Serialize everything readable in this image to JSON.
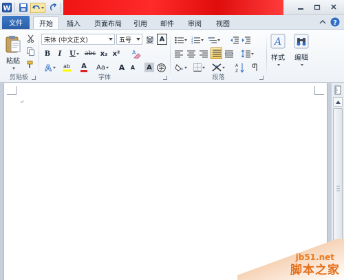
{
  "title_bar": {
    "qat": [
      "word-icon",
      "save-icon",
      "undo-icon",
      "redo-icon",
      "customize-icon"
    ]
  },
  "tabs": {
    "file": "文件",
    "items": [
      "开始",
      "插入",
      "页面布局",
      "引用",
      "邮件",
      "审阅",
      "视图"
    ],
    "active": "开始"
  },
  "clipboard": {
    "paste": "粘贴",
    "label": "剪贴板"
  },
  "font": {
    "name": "宋体 (中文正文)",
    "size": "五号",
    "label": "字体",
    "bold": "B",
    "italic": "I",
    "underline": "U",
    "strike": "abc",
    "subscript": "x₂",
    "superscript": "x²",
    "case": "Aa",
    "grow": "A",
    "shrink": "A",
    "phonetic": "wén",
    "char_border": "A",
    "highlight": "ab",
    "color": "A",
    "char_shading": "A",
    "enclose": "字"
  },
  "paragraph": {
    "label": "段落"
  },
  "styles": {
    "label": "样式"
  },
  "editing": {
    "label": "编辑"
  },
  "watermark": {
    "site": "jb51.net",
    "name": "脚本之家"
  },
  "colors": {
    "file_tab": "#2a5fa8",
    "accent_orange": "#e87b23"
  }
}
